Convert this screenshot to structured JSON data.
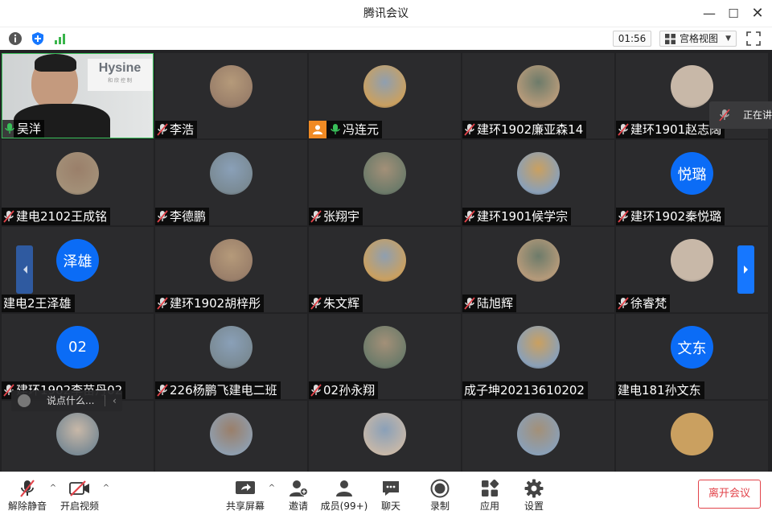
{
  "window": {
    "title": "腾讯会议",
    "minimize_label": "—",
    "maximize_label": "☐",
    "close_label": "✕"
  },
  "infobar": {
    "timer": "01:56",
    "view_mode": "宫格视图"
  },
  "participants": [
    {
      "name": "吴洋",
      "speaker": true,
      "mic": "on"
    },
    {
      "name": "李浩",
      "mic": "muted"
    },
    {
      "name": "冯连元",
      "mic": "on",
      "host": true
    },
    {
      "name": "建环1902廉亚森14",
      "mic": "muted"
    },
    {
      "name": "建环1901赵志阔",
      "mic": "muted"
    },
    {
      "name": "建电2102王成铭",
      "mic": "muted"
    },
    {
      "name": "李德鹏",
      "mic": "muted"
    },
    {
      "name": "张翔宇",
      "mic": "muted"
    },
    {
      "name": "建环1901候学宗",
      "mic": "muted"
    },
    {
      "name": "建环1902秦悦璐",
      "mic": "muted",
      "avatar_text": "悦璐"
    },
    {
      "name": "建电2王泽雄",
      "mic": "none",
      "avatar_text": "泽雄"
    },
    {
      "name": "建环1902胡梓彤",
      "mic": "muted"
    },
    {
      "name": "朱文辉",
      "mic": "muted"
    },
    {
      "name": "陆旭辉",
      "mic": "muted"
    },
    {
      "name": "徐睿梵",
      "mic": "muted"
    },
    {
      "name": "建环1902李苗丹02",
      "mic": "muted",
      "avatar_text": "02"
    },
    {
      "name": "226杨鹏飞建电二班",
      "mic": "muted"
    },
    {
      "name": "02孙永翔",
      "mic": "muted"
    },
    {
      "name": "成子坤20213610202",
      "mic": "none"
    },
    {
      "name": "建电181孙文东",
      "mic": "none",
      "avatar_text": "文东"
    },
    {
      "name": "",
      "mic": "none",
      "cut": true
    },
    {
      "name": "",
      "mic": "none",
      "cut": true
    },
    {
      "name": "",
      "mic": "none",
      "cut": true
    },
    {
      "name": "",
      "mic": "none",
      "cut": true
    },
    {
      "name": "",
      "mic": "none",
      "cut": true
    }
  ],
  "speaker_logo": {
    "brand": "Hysine",
    "tagline": "和 欣 控 制"
  },
  "speaking_popup": "正在讲",
  "chat_input": {
    "placeholder": "说点什么...",
    "collapse": "‹"
  },
  "toolbar": {
    "unmute": "解除静音",
    "start_video": "开启视频",
    "share_screen": "共享屏幕",
    "invite": "邀请",
    "members": "成员(99+)",
    "chat": "聊天",
    "record": "录制",
    "apps": "应用",
    "settings": "设置",
    "leave": "离开会议"
  },
  "colors": {
    "accent": "#1677ff",
    "leave": "#e2434a",
    "speaker_border": "#39c05a",
    "host_badge": "#f08a24"
  }
}
